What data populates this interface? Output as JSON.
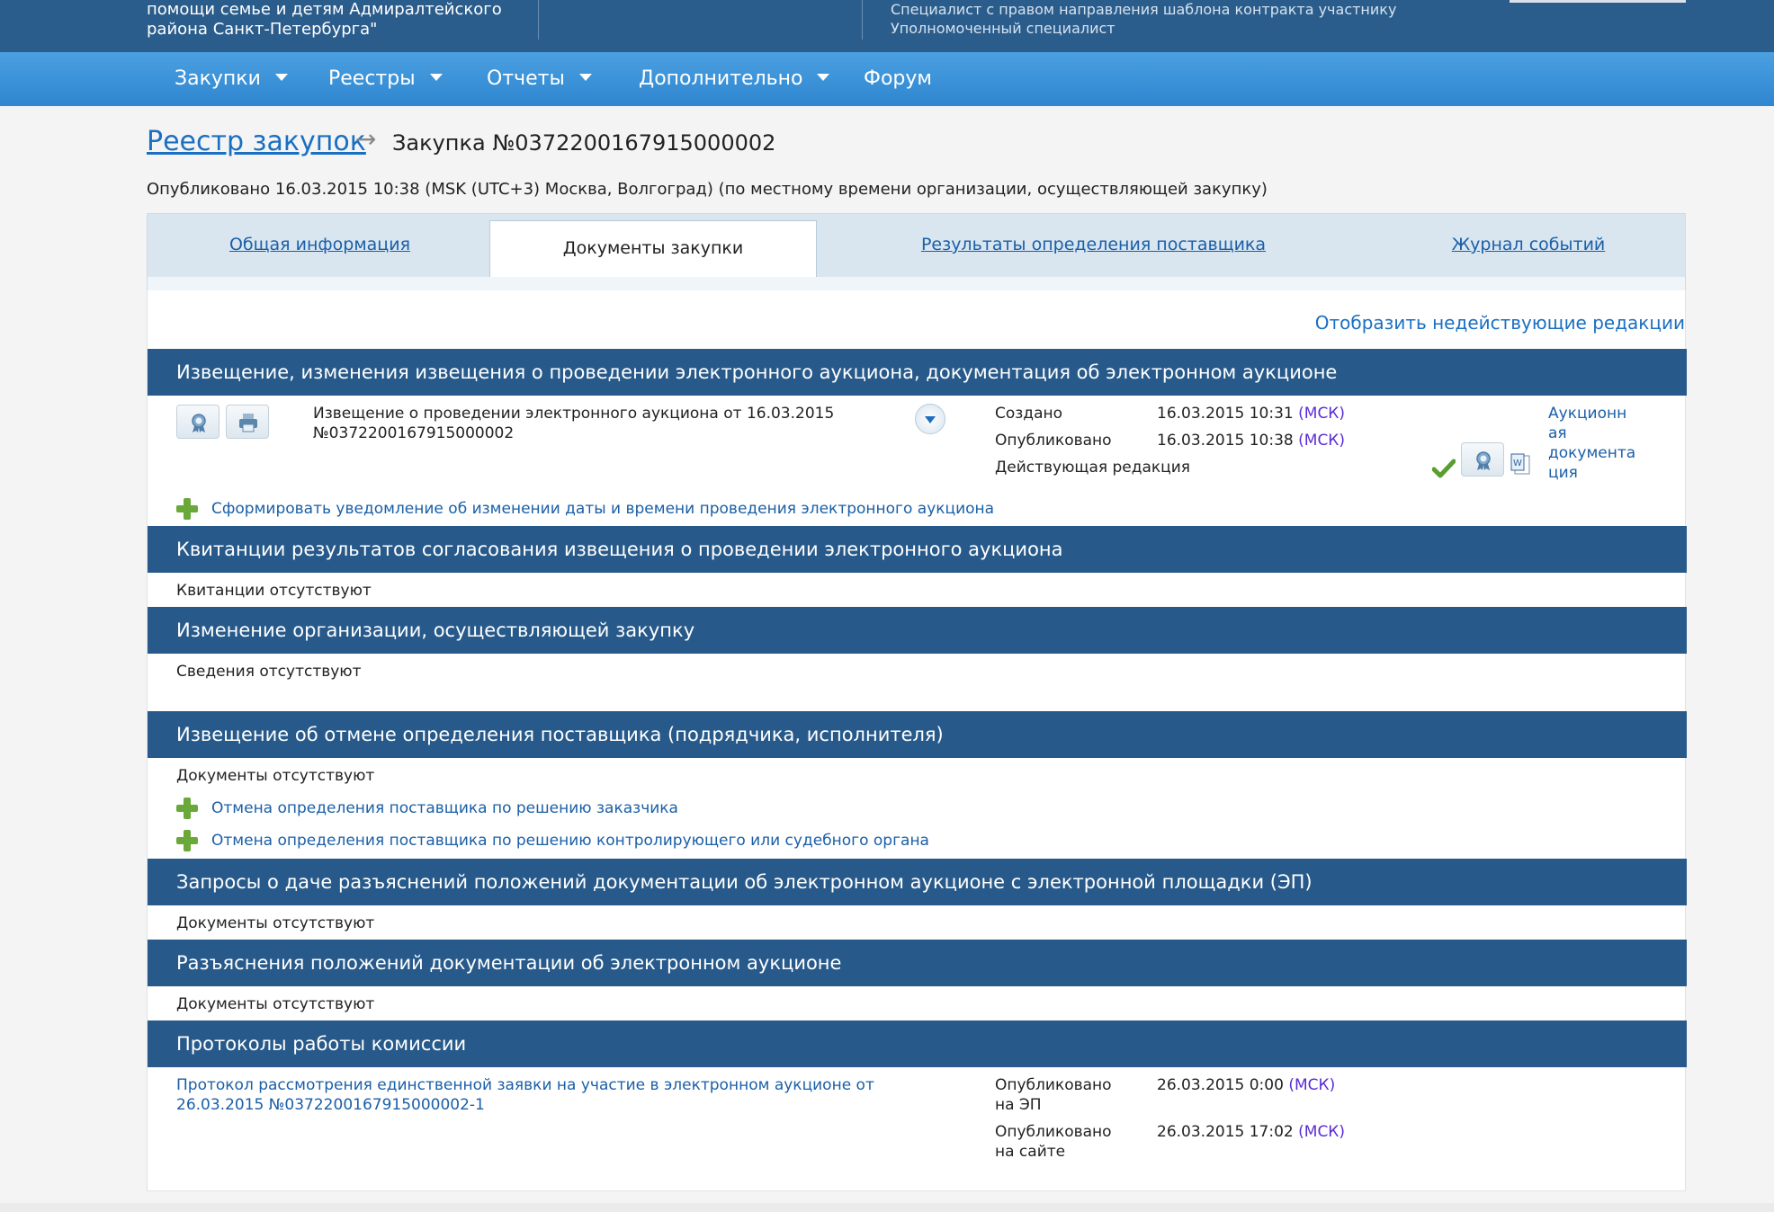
{
  "header": {
    "org_line1": "помощи семье и детям Адмиралтейского",
    "org_line2": "района Санкт-Петербурга\"",
    "role_line1": "Специалист с правом направления шаблона контракта участнику",
    "role_line2": "Уполномоченный специалист"
  },
  "nav": {
    "items": [
      {
        "label": "Закупки"
      },
      {
        "label": "Реестры"
      },
      {
        "label": "Отчеты"
      },
      {
        "label": "Дополнительно"
      },
      {
        "label": "Форум"
      }
    ]
  },
  "breadcrumb": {
    "root": "Реестр закупок",
    "arrow": "→",
    "current": "Закупка №0372200167915000002"
  },
  "published_info": "Опубликовано 16.03.2015 10:38 (MSK (UTC+3) Москва, Волгоград) (по местному времени организации, осуществляющей закупку)",
  "tabs": [
    {
      "label": "Общая информация",
      "active": false
    },
    {
      "label": "Документы закупки",
      "active": true
    },
    {
      "label": "Результаты определения поставщика",
      "active": false
    },
    {
      "label": "Журнал событий",
      "active": false
    }
  ],
  "show_inactive_link": "Отобразить недействующие редакции",
  "sections": {
    "notice": {
      "title": "Извещение, изменения извещения о проведении электронного аукциона, документация об электронном аукционе",
      "doc_line1": "Извещение о проведении электронного аукциона от 16.03.2015",
      "doc_line2": "№0372200167915000002",
      "created_label": "Создано",
      "created_value": "16.03.2015 10:31",
      "published_label": "Опубликовано",
      "published_value": "16.03.2015 10:38",
      "tz": "(МСК)",
      "status": "Действующая редакция",
      "attachment_line1": "Аукционн",
      "attachment_line2": "ая",
      "attachment_line3": "документа",
      "attachment_line4": "ция",
      "action": "Сформировать уведомление об изменении даты и времени проведения электронного аукциона"
    },
    "receipts": {
      "title": "Квитанции результатов согласования извещения о проведении электронного аукциона",
      "empty": "Квитанции отсутствуют"
    },
    "org_change": {
      "title": "Изменение организации, осуществляющей закупку",
      "empty": "Сведения отсутствуют"
    },
    "cancel": {
      "title": "Извещение об отмене определения поставщика (подрядчика, исполнителя)",
      "empty": "Документы отсутствуют",
      "action1": "Отмена определения поставщика по решению заказчика",
      "action2": "Отмена определения поставщика по решению контролирующего или судебного органа"
    },
    "requests": {
      "title": "Запросы о даче разъяснений положений документации об электронном аукционе с электронной площадки (ЭП)",
      "empty": "Документы отсутствуют"
    },
    "explanations": {
      "title": "Разъяснения положений документации об электронном аукционе",
      "empty": "Документы отсутствуют"
    },
    "protocols": {
      "title": "Протоколы работы комиссии",
      "doc_line1": "Протокол рассмотрения единственной заявки на участие в электронном аукционе от",
      "doc_line2": "26.03.2015 №0372200167915000002-1",
      "pub_ep_label1": "Опубликовано",
      "pub_ep_label2": "на ЭП",
      "pub_ep_value": "26.03.2015 0:00",
      "pub_site_label1": "Опубликовано",
      "pub_site_label2": "на сайте",
      "pub_site_value": "26.03.2015 17:02",
      "tz": "(МСК)"
    }
  }
}
